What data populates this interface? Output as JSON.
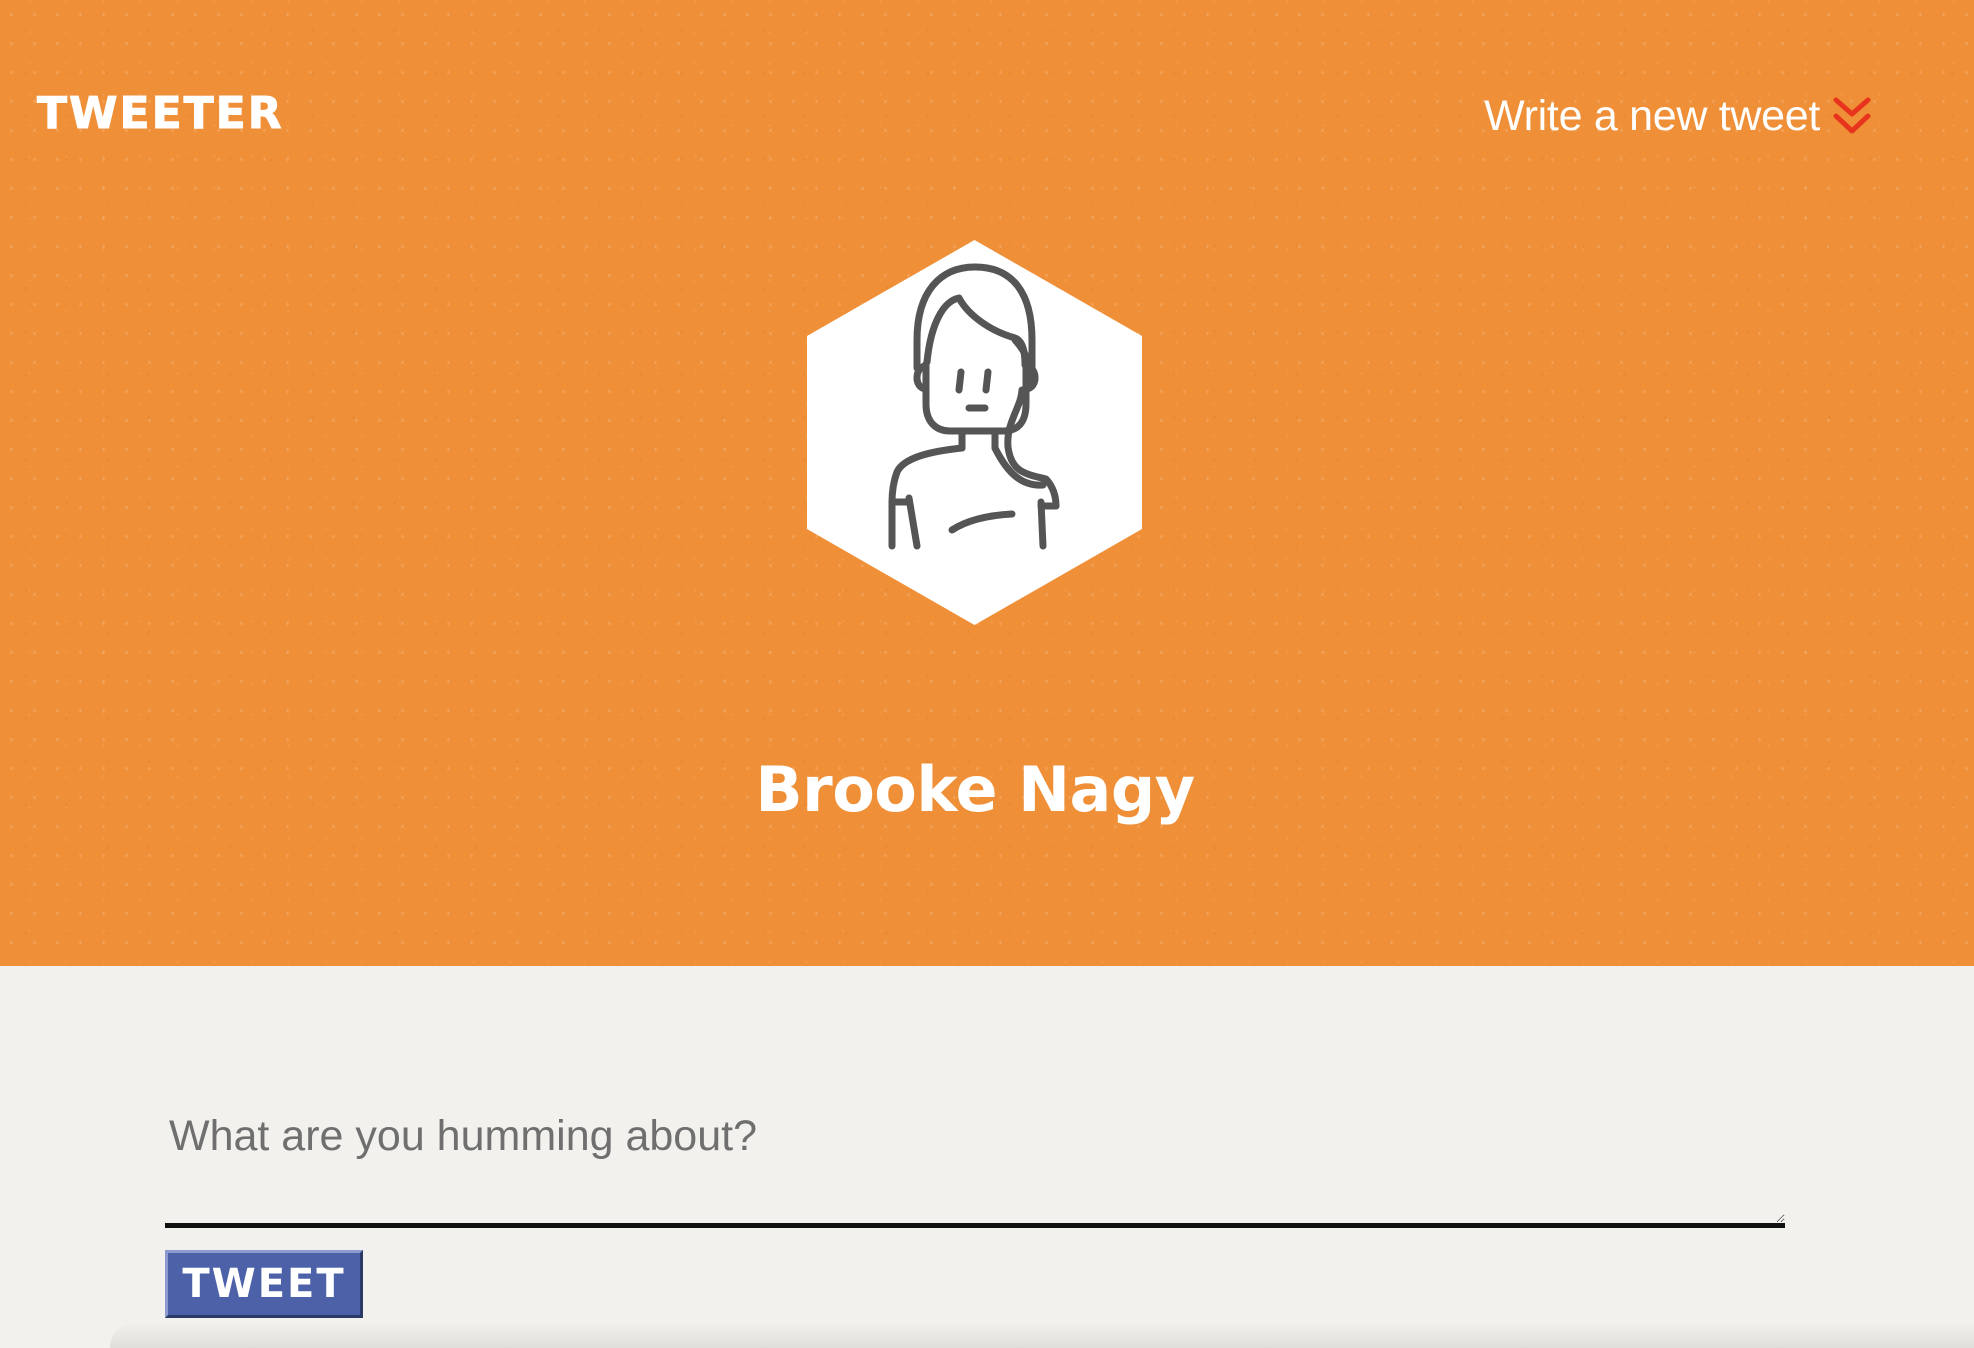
{
  "app": {
    "logo_text": "TWEETER"
  },
  "nav": {
    "new_tweet_link_label": "Write a new tweet",
    "new_tweet_link_icon": "double-chevron-down-icon",
    "icon_color": "#e8341c"
  },
  "profile": {
    "name": "Brooke Nagy",
    "avatar_icon": "woman-avatar-icon",
    "avatar_shape": "hexagon"
  },
  "compose": {
    "placeholder": "What are you humming about?",
    "value": "",
    "submit_label": "TWEET"
  },
  "colors": {
    "hero_background": "#ef8f37",
    "page_background": "#f3f1ed",
    "button_background": "#4c61a8",
    "text_on_hero": "#ffffff"
  }
}
